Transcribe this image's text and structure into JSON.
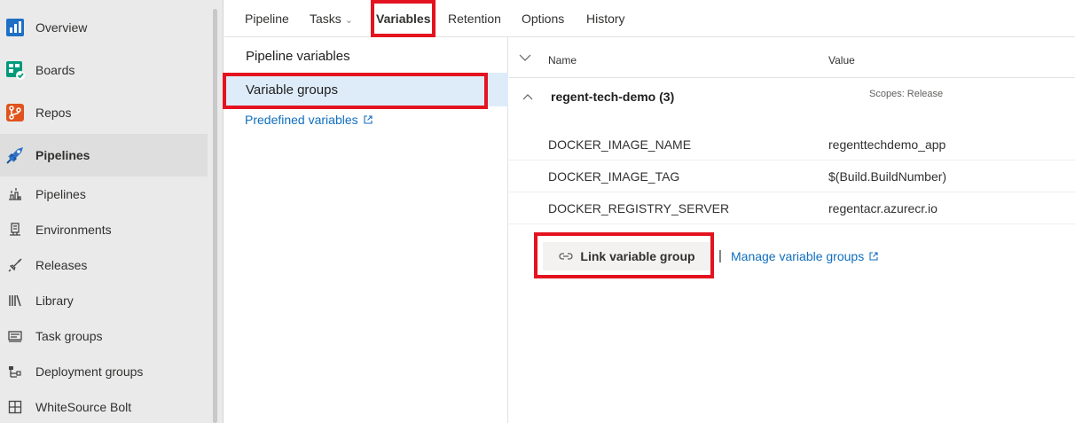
{
  "nav": {
    "primary": [
      {
        "label": "Overview",
        "icon": "overview-icon"
      },
      {
        "label": "Boards",
        "icon": "boards-icon"
      },
      {
        "label": "Repos",
        "icon": "repos-icon"
      },
      {
        "label": "Pipelines",
        "icon": "pipelines-icon"
      }
    ],
    "sub": [
      {
        "label": "Pipelines",
        "icon": "pipelines-sub-icon"
      },
      {
        "label": "Environments",
        "icon": "environments-icon"
      },
      {
        "label": "Releases",
        "icon": "releases-icon"
      },
      {
        "label": "Library",
        "icon": "library-icon"
      },
      {
        "label": "Task groups",
        "icon": "task-groups-icon"
      },
      {
        "label": "Deployment groups",
        "icon": "deployment-groups-icon"
      },
      {
        "label": "WhiteSource Bolt",
        "icon": "whitesource-icon"
      }
    ]
  },
  "tabs": [
    {
      "label": "Pipeline"
    },
    {
      "label": "Tasks"
    },
    {
      "label": "Variables"
    },
    {
      "label": "Retention"
    },
    {
      "label": "Options"
    },
    {
      "label": "History"
    }
  ],
  "variables_nav": {
    "pipeline_variables": "Pipeline variables",
    "variable_groups": "Variable groups",
    "predefined_variables": "Predefined variables"
  },
  "grid": {
    "header_name": "Name",
    "header_value": "Value",
    "group": {
      "title": "regent-tech-demo (3)",
      "scope": "Scopes: Release",
      "variables": [
        {
          "name": "DOCKER_IMAGE_NAME",
          "value": "regenttechdemo_app"
        },
        {
          "name": "DOCKER_IMAGE_TAG",
          "value": "$(Build.BuildNumber)"
        },
        {
          "name": "DOCKER_REGISTRY_SERVER",
          "value": "regentacr.azurecr.io"
        }
      ]
    },
    "link_button": "Link variable group",
    "separator": "|",
    "manage_link": "Manage variable groups"
  },
  "colors": {
    "accent": "#0078d4",
    "link": "#106ebe",
    "highlight": "#e3131f",
    "selected_bg": "#deecf9"
  }
}
